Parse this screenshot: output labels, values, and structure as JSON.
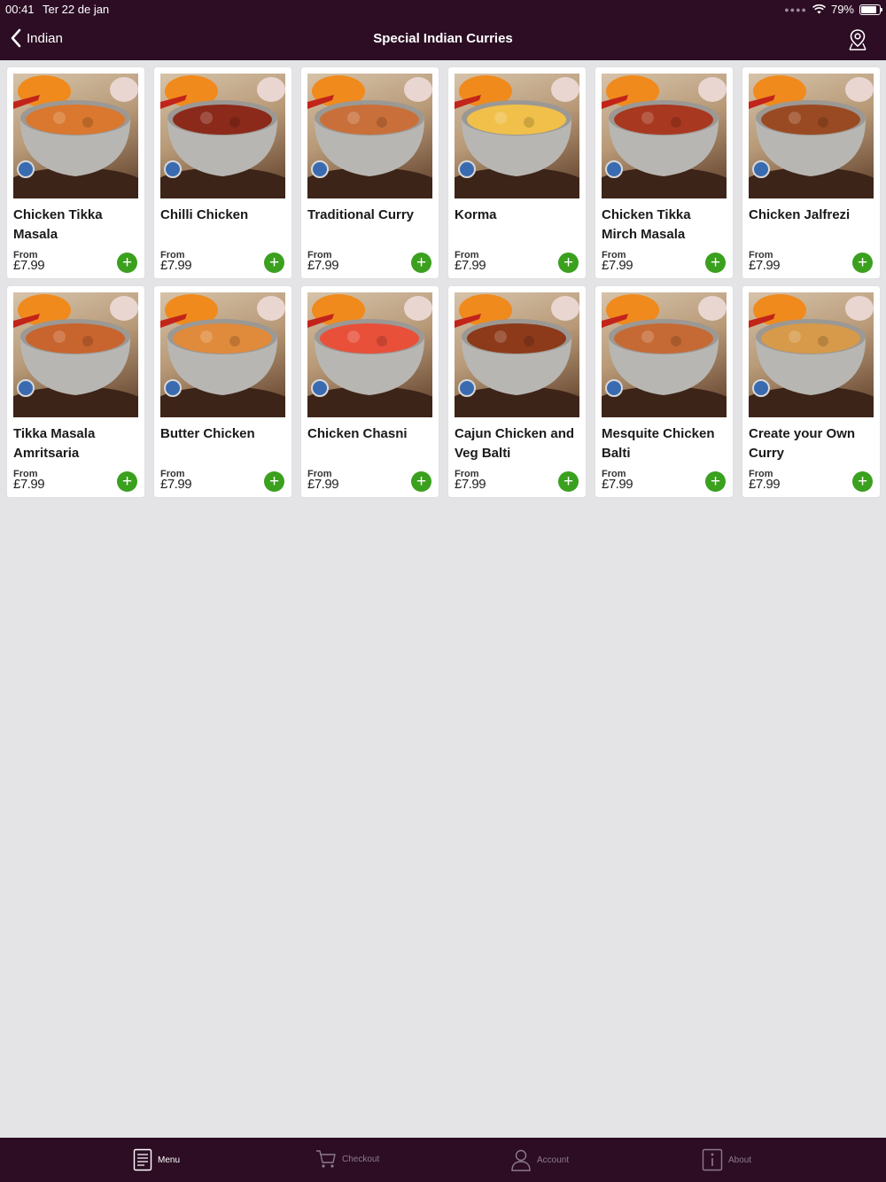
{
  "status_bar": {
    "time": "00:41",
    "date": "Ter 22 de jan",
    "battery": "79%",
    "battery_level": 0.79
  },
  "nav": {
    "back_label": "Indian",
    "title": "Special Indian Curries"
  },
  "products": [
    {
      "name": "Chicken Tikka Masala",
      "from_label": "From",
      "price": "£7.99",
      "sauce_color": "#d9782e"
    },
    {
      "name": "Chilli Chicken",
      "from_label": "From",
      "price": "£7.99",
      "sauce_color": "#8b2a1a"
    },
    {
      "name": "Traditional Curry",
      "from_label": "From",
      "price": "£7.99",
      "sauce_color": "#c9703a"
    },
    {
      "name": "Korma",
      "from_label": "From",
      "price": "£7.99",
      "sauce_color": "#f0c04a"
    },
    {
      "name": "Chicken Tikka Mirch Masala",
      "from_label": "From",
      "price": "£7.99",
      "sauce_color": "#a8381f"
    },
    {
      "name": "Chicken Jalfrezi",
      "from_label": "From",
      "price": "£7.99",
      "sauce_color": "#9a4a22"
    },
    {
      "name": "Tikka Masala Amritsaria",
      "from_label": "From",
      "price": "£7.99",
      "sauce_color": "#c8642e"
    },
    {
      "name": "Butter Chicken",
      "from_label": "From",
      "price": "£7.99",
      "sauce_color": "#e08a3c"
    },
    {
      "name": "Chicken Chasni",
      "from_label": "From",
      "price": "£7.99",
      "sauce_color": "#e8503a"
    },
    {
      "name": "Cajun Chicken and Veg Balti",
      "from_label": "From",
      "price": "£7.99",
      "sauce_color": "#8c3a1a"
    },
    {
      "name": "Mesquite Chicken Balti",
      "from_label": "From",
      "price": "£7.99",
      "sauce_color": "#c66a35"
    },
    {
      "name": "Create your Own Curry",
      "from_label": "From",
      "price": "£7.99",
      "sauce_color": "#d69a4a"
    }
  ],
  "tabs": [
    {
      "label": "Menu",
      "icon": "menu-icon",
      "active": true
    },
    {
      "label": "Checkout",
      "icon": "cart-icon",
      "active": false
    },
    {
      "label": "Account",
      "icon": "account-icon",
      "active": false
    },
    {
      "label": "About",
      "icon": "info-icon",
      "active": false
    }
  ],
  "colors": {
    "nav_bg": "#2c0d24",
    "add_button": "#3aa01e",
    "page_bg": "#e4e4e7",
    "tab_inactive": "#8d7b89"
  }
}
